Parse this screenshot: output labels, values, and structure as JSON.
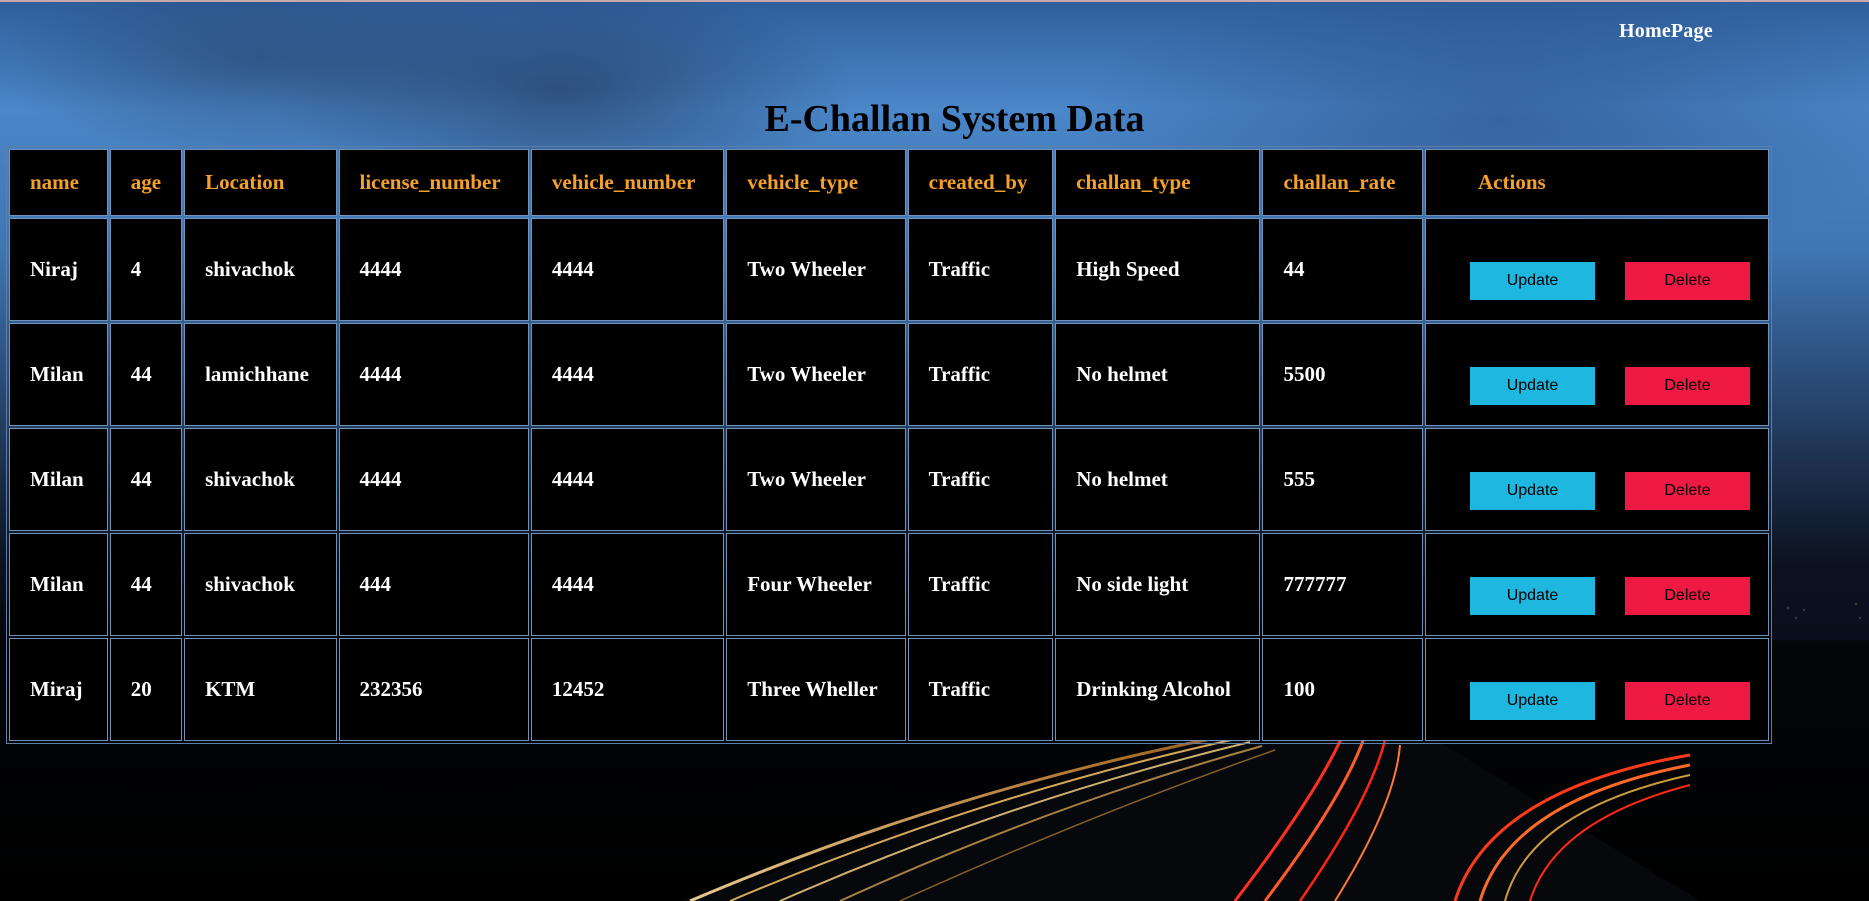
{
  "nav": {
    "home_label": "HomePage"
  },
  "page": {
    "title": "E-Challan System Data"
  },
  "table": {
    "columns": [
      "name",
      "age",
      "Location",
      "license_number",
      "vehicle_number",
      "vehicle_type",
      "created_by",
      "challan_type",
      "challan_rate",
      "Actions"
    ],
    "rows": [
      {
        "name": "Niraj",
        "age": "4",
        "location": "shivachok",
        "license_number": "4444",
        "vehicle_number": "4444",
        "vehicle_type": "Two Wheeler",
        "created_by": "Traffic",
        "challan_type": "High Speed",
        "challan_rate": "44"
      },
      {
        "name": "Milan",
        "age": "44",
        "location": "lamichhane",
        "license_number": "4444",
        "vehicle_number": "4444",
        "vehicle_type": "Two Wheeler",
        "created_by": "Traffic",
        "challan_type": "No helmet",
        "challan_rate": "5500"
      },
      {
        "name": "Milan",
        "age": "44",
        "location": "shivachok",
        "license_number": "4444",
        "vehicle_number": "4444",
        "vehicle_type": "Two Wheeler",
        "created_by": "Traffic",
        "challan_type": "No helmet",
        "challan_rate": "555"
      },
      {
        "name": "Milan",
        "age": "44",
        "location": "shivachok",
        "license_number": "444",
        "vehicle_number": "4444",
        "vehicle_type": "Four Wheeler",
        "created_by": "Traffic",
        "challan_type": "No side light",
        "challan_rate": "777777"
      },
      {
        "name": "Miraj",
        "age": "20",
        "location": "KTM",
        "license_number": "232356",
        "vehicle_number": "12452",
        "vehicle_type": "Three Wheller",
        "created_by": "Traffic",
        "challan_type": "Drinking Alcohol",
        "challan_rate": "100"
      }
    ],
    "actions": {
      "update_label": "Update",
      "delete_label": "Delete"
    }
  },
  "colors": {
    "header_text": "#f5a02a",
    "cell_text": "#ffffff",
    "cell_background": "#000000",
    "update_button": "#1db7e0",
    "delete_button": "#ee1a43"
  }
}
